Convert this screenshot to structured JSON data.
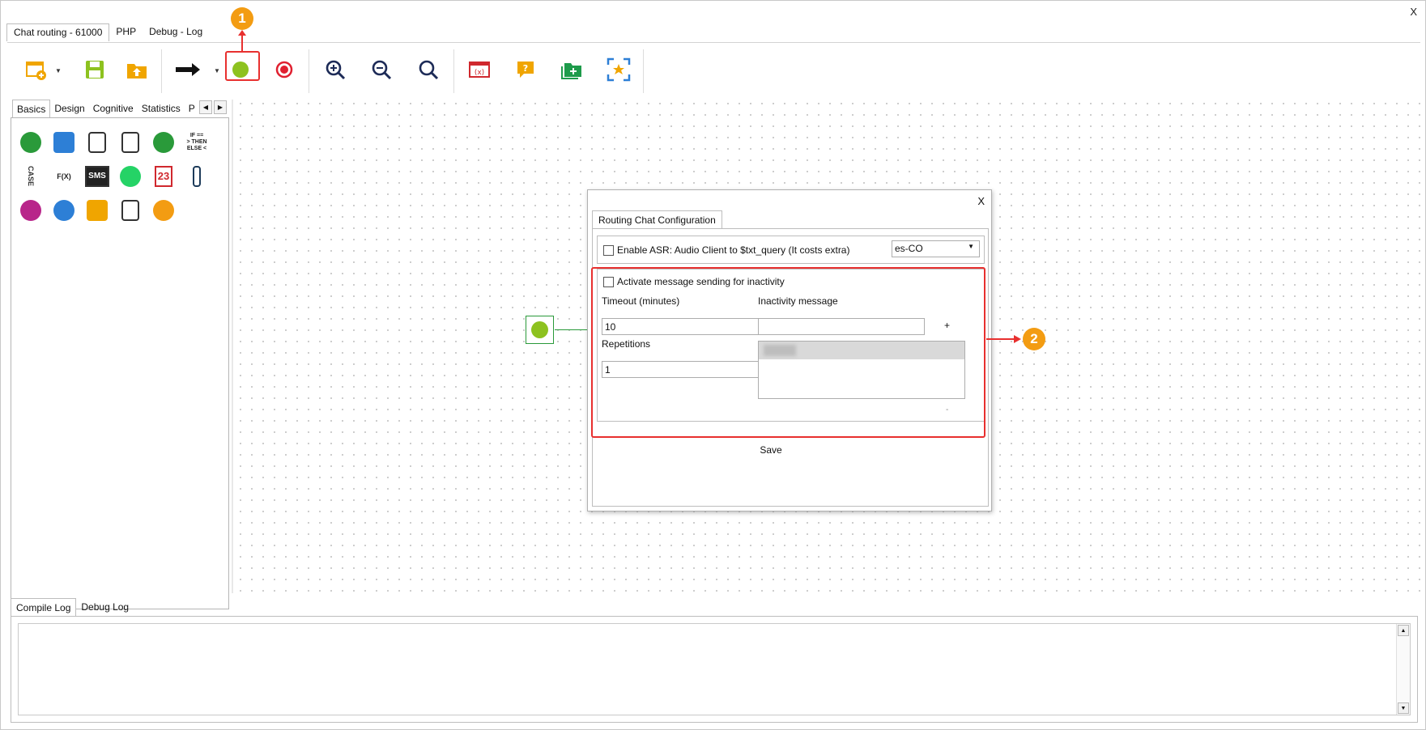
{
  "window": {
    "close_label": "X"
  },
  "top_tabs": [
    "Chat routing - 61000",
    "PHP",
    "Debug - Log"
  ],
  "toolbar": {
    "buttons": [
      "new-flow",
      "save",
      "upload",
      "connector-arrow",
      "start-node",
      "end-node",
      "zoom-in",
      "zoom-out",
      "zoom-reset",
      "variables",
      "help",
      "add-folder",
      "fit-to-screen"
    ]
  },
  "palette": {
    "tabs": [
      "Basics",
      "Design",
      "Cognitive",
      "Statistics",
      "P"
    ],
    "icons": [
      {
        "name": "chat-message-icon",
        "text": "",
        "color": "#2a9a3a"
      },
      {
        "name": "speaker-icon",
        "text": "",
        "color": "#2d7fd6"
      },
      {
        "name": "math-operators-icon",
        "text": "",
        "color": "#333333"
      },
      {
        "name": "percent-calc-icon",
        "text": "",
        "color": "#333333"
      },
      {
        "name": "web-service-icon",
        "text": "",
        "color": "#2a9a3a"
      },
      {
        "name": "if-then-else-icon",
        "text": "IF ==\n> THEN\nELSE <",
        "color": "#222222"
      },
      {
        "name": "case-icon",
        "text": "CASE",
        "color": "#333333"
      },
      {
        "name": "function-icon",
        "text": "F(X)",
        "color": "#222222"
      },
      {
        "name": "sms-icon",
        "text": "SMS",
        "color": "#333333"
      },
      {
        "name": "whatsapp-icon",
        "text": "",
        "color": "#25d366"
      },
      {
        "name": "calendar-icon",
        "text": "23",
        "color": "#d0282e"
      },
      {
        "name": "attachment-icon",
        "text": "",
        "color": "#1d3b5a"
      },
      {
        "name": "globe-icon",
        "text": "",
        "color": "#b8258a"
      },
      {
        "name": "alarm-clock-icon",
        "text": "",
        "color": "#2d7fd6"
      },
      {
        "name": "trophy-icon",
        "text": "",
        "color": "#f0a500"
      },
      {
        "name": "send-icon",
        "text": "",
        "color": "#333333"
      },
      {
        "name": "alert-timer-icon",
        "text": "",
        "color": "#f39c12"
      }
    ]
  },
  "logs": {
    "tabs": [
      "Compile Log",
      "Debug Log"
    ]
  },
  "dialog": {
    "close_label": "X",
    "tab": "Routing Chat Configuration",
    "asr_label": "Enable ASR: Audio Client to $txt_query (It costs extra)",
    "language": "es-CO",
    "inactivity_label": "Activate message sending for inactivity",
    "timeout_label": "Timeout (minutes)",
    "timeout_value": "10",
    "repetitions_label": "Repetitions",
    "repetitions_value": "1",
    "message_label": "Inactivity message",
    "plus_label": "+",
    "minus_label": "-",
    "save_label": "Save"
  },
  "annotations": {
    "badge1": "1",
    "badge2": "2",
    "accent": "#f39c12",
    "highlight": "#e8302f"
  }
}
